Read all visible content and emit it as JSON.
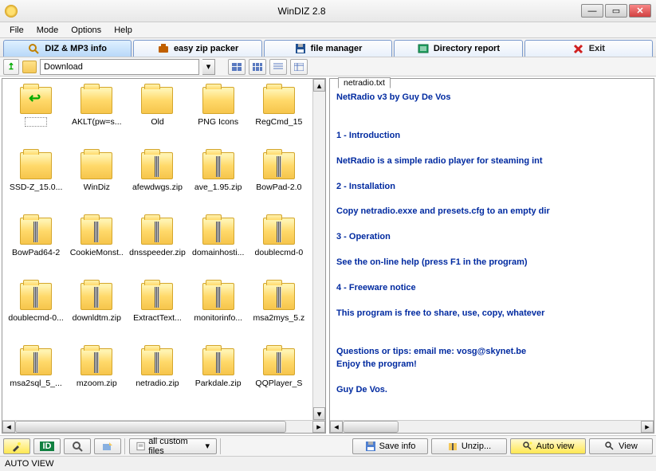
{
  "window": {
    "title": "WinDIZ 2.8"
  },
  "menus": [
    "File",
    "Mode",
    "Options",
    "Help"
  ],
  "tabs": [
    {
      "label": "DIZ & MP3 info",
      "active": true,
      "icon": "search-doc"
    },
    {
      "label": "easy zip packer",
      "icon": "briefcase"
    },
    {
      "label": "file manager",
      "icon": "disk"
    },
    {
      "label": "Directory report",
      "icon": "report"
    },
    {
      "label": "Exit",
      "icon": "exit"
    }
  ],
  "nav": {
    "path": "Download"
  },
  "files": [
    {
      "name": "..",
      "type": "up"
    },
    {
      "name": "",
      "type": "sel"
    },
    {
      "name": "AKLT(pw=s...",
      "type": "folder"
    },
    {
      "name": "Old",
      "type": "folder"
    },
    {
      "name": "PNG Icons",
      "type": "folder"
    },
    {
      "name": "RegCmd_15",
      "type": "folder"
    },
    {
      "name": "SSD-Z_15.0...",
      "type": "folder"
    },
    {
      "name": "WinDiz",
      "type": "folder"
    },
    {
      "name": "afewdwgs.zip",
      "type": "zip"
    },
    {
      "name": "ave_1.95.zip",
      "type": "zip"
    },
    {
      "name": "BowPad-2.0",
      "type": "zip"
    },
    {
      "name": "BowPad64-2",
      "type": "zip"
    },
    {
      "name": "CookieMonst..",
      "type": "zip"
    },
    {
      "name": "dnsspeeder.zip",
      "type": "zip"
    },
    {
      "name": "domainhosti...",
      "type": "zip"
    },
    {
      "name": "doublecmd-0",
      "type": "zip"
    },
    {
      "name": "doublecmd-0...",
      "type": "zip"
    },
    {
      "name": "downldtm.zip",
      "type": "zip"
    },
    {
      "name": "ExtractText...",
      "type": "zip"
    },
    {
      "name": "monitorinfo...",
      "type": "zip"
    },
    {
      "name": "msa2mys_5.z",
      "type": "zip"
    },
    {
      "name": "msa2sql_5_...",
      "type": "zip"
    },
    {
      "name": "mzoom.zip",
      "type": "zip"
    },
    {
      "name": "netradio.zip",
      "type": "zip"
    },
    {
      "name": "Parkdale.zip",
      "type": "zip"
    },
    {
      "name": "QQPlayer_S",
      "type": "zip"
    }
  ],
  "preview": {
    "tab": "netradio.txt",
    "lines": [
      "NetRadio v3 by Guy De Vos",
      "",
      "",
      "1 - Introduction",
      "",
      "NetRadio is a simple radio player for steaming int",
      "",
      "2 - Installation",
      "",
      "Copy netradio.exxe and presets.cfg to an empty dir",
      "",
      "3 - Operation",
      "",
      "See the on-line help (press F1 in the program)",
      "",
      "4 - Freeware notice",
      "",
      "This program is free to share, use, copy, whatever",
      "",
      "",
      "Questions or tips: email me: vosg@skynet.be",
      "Enjoy the program!",
      "",
      "Guy De Vos."
    ]
  },
  "buttons": {
    "filter": "all custom files",
    "save": "Save info",
    "unzip": "Unzip...",
    "autoview": "Auto view",
    "view": "View"
  },
  "status": "AUTO VIEW"
}
